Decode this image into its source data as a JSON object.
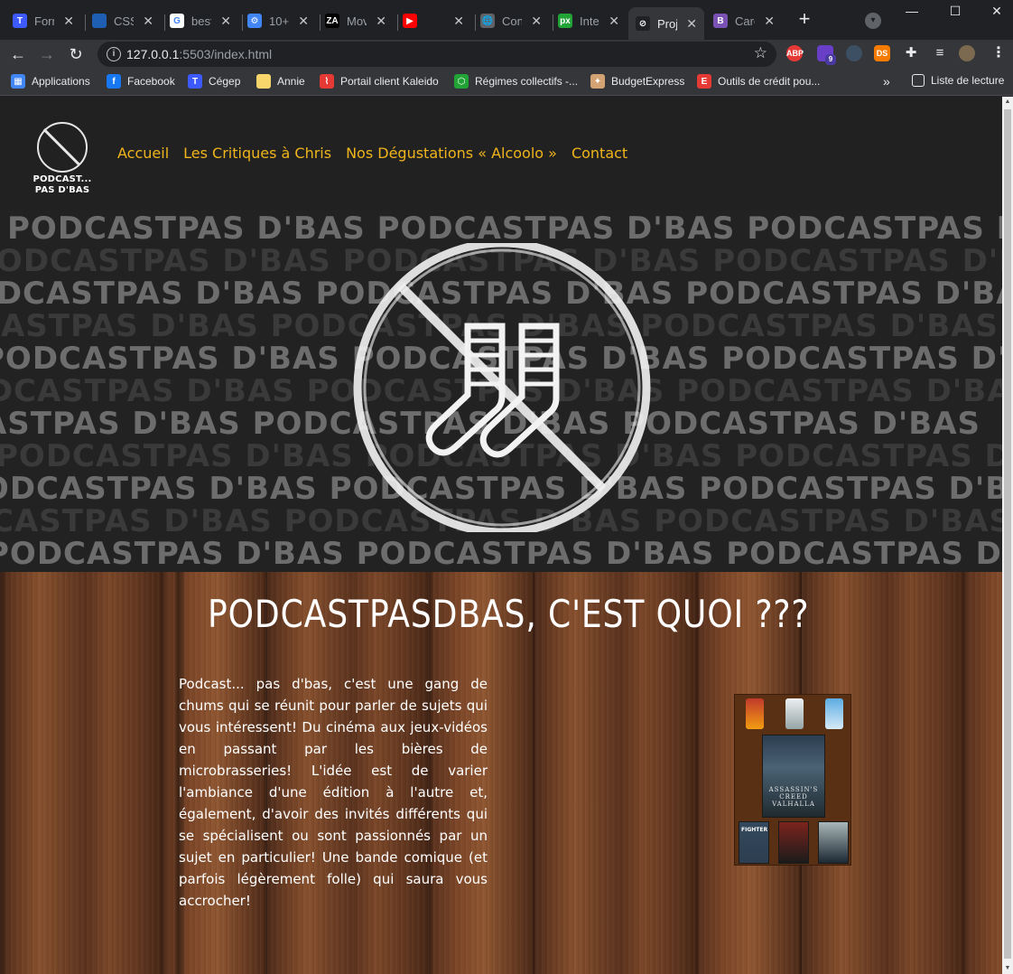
{
  "browser": {
    "tabs": [
      {
        "label": "Form",
        "favicon": "T",
        "color": "#3d5afe",
        "active": false
      },
      {
        "label": "CSS",
        "favicon": "",
        "color": "#1e5fb4",
        "active": false
      },
      {
        "label": "best",
        "favicon": "G",
        "color": "#ffffff",
        "active": false
      },
      {
        "label": "10+",
        "favicon": "⚙",
        "color": "#4285f4",
        "active": false
      },
      {
        "label": "Mov",
        "favicon": "ZA",
        "color": "#000000",
        "active": false
      },
      {
        "label": "",
        "favicon": "▶",
        "color": "#ff0000",
        "active": false
      },
      {
        "label": "Con",
        "favicon": "🌐",
        "color": "#5f6368",
        "active": false
      },
      {
        "label": "Inte",
        "favicon": "px",
        "color": "#21a336",
        "active": false
      },
      {
        "label": "Proj",
        "favicon": "⊘",
        "color": "#202124",
        "active": true
      },
      {
        "label": "Carc",
        "favicon": "B",
        "color": "#7952b3",
        "active": false
      }
    ],
    "url_host": "127.0.0.1",
    "url_rest": ":5503/index.html",
    "extension_badge": "9",
    "bookmarks": [
      {
        "label": "Applications",
        "icon": "apps-grid-icon"
      },
      {
        "label": "Facebook",
        "icon": "facebook-icon"
      },
      {
        "label": "Cégep",
        "icon": "cegep-icon"
      },
      {
        "label": "Annie",
        "icon": "folder-icon"
      },
      {
        "label": "Portail client Kaleido",
        "icon": "kaleido-icon"
      },
      {
        "label": "Régimes collectifs -...",
        "icon": "hexagon-icon"
      },
      {
        "label": "BudgetExpress",
        "icon": "budget-icon"
      },
      {
        "label": "Outils de crédit pou...",
        "icon": "equifax-icon"
      }
    ],
    "reading_list": "Liste de lecture"
  },
  "site": {
    "logo_line1": "PODCAST...",
    "logo_line2": "PAS D'BAS",
    "nav": [
      "Accueil",
      "Les Critiques à Chris",
      "Nos Dégustations « Alcoolo »",
      "Contact"
    ],
    "hero_word": "PODCASTPAS D'BAS",
    "about_title": "PodcastPasDBas, c'est quoi ???",
    "about_text": "Podcast... pas d'bas, c'est une gang de chums qui se réunit pour parler de sujets qui vous intéressent! Du cinéma aux jeux-vidéos en passant par les bières de microbrasseries! L'idée est de varier l'ambiance d'une édition à l'autre et, également, d'avoir des invités différents qui se spécialisent ou sont passionnés par un sujet en particulier! Une bande comique (et parfois légèrement folle) qui saura vous accrocher!",
    "collage": {
      "main_poster": "ASSASSIN'S CREED VALHALLA",
      "mini_posters": [
        "FIGHTER",
        "",
        ""
      ]
    }
  },
  "colors": {
    "nav_link": "#f0b51c",
    "header_bg": "#212121",
    "hero_light_text": "#6d6d6d",
    "hero_dark_text": "#3a3a3a"
  }
}
